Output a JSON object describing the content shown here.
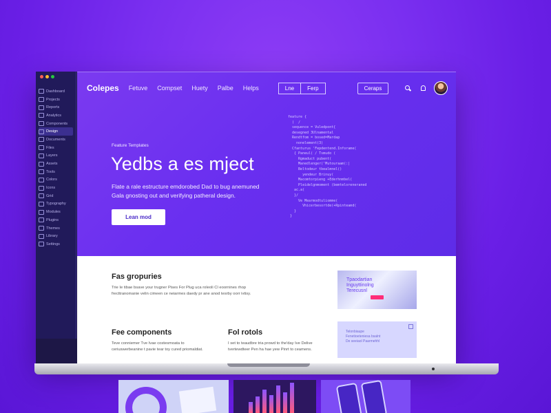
{
  "sidebar": {
    "items": [
      "Dashboard",
      "Projects",
      "Reports",
      "Analytics",
      "Components",
      "Design",
      "Documents",
      "Files",
      "Layers",
      "Assets",
      "Tools",
      "Colors",
      "Icons",
      "Grid",
      "Typography",
      "Modules",
      "Plugins",
      "Themes",
      "Library",
      "Settings"
    ]
  },
  "topnav": {
    "brand": "Colepes",
    "links": [
      "Fetuve",
      "Compset",
      "Huety",
      "Palbe",
      "Helps"
    ],
    "btn_group": [
      "Lne",
      "Ferp"
    ],
    "cta": "Ceraps"
  },
  "hero": {
    "eyebrow": "Feature Templates",
    "title": "Yedbs a es mject",
    "subtitle": "Flate a rale estructure emdorobed Dad to bug anemuned Gala gnosting out and verifying patheral design.",
    "button": "Lean mod"
  },
  "code": [
    "feature {",
    "  (  /",
    "  sequence = Vuledpont{",
    "  desegned 3Ulnamental",
    "  Rendtfom = bosed=Mardap",
    "    nonelement(3)",
    "",
    "  Cfanturus 'Fepdentend.Inforame(",
    "   { Paneul( / Tsmudo (  ",
    "     Rgmaduct pubent(",
    "     Manedlenger('Mutouraam(:|",
    "     Beltodeur tbealmnel()",
    "       yendeur Brinuy(",
    "     Macomtorpieng +Ederhnmbel(",
    "     Pleidelgnmoment (bemteloreneraned",
    "   ac.a(",
    "   }/",
    "     Ve Mearmodtuliomme(",
    "       Vhicerbesortde(+Rpinteamd(",
    "   }",
    " }"
  ],
  "sections": [
    {
      "title": "Fas gropuries",
      "text": "Trie Ie tibae bsave your trugner Pises For Plug uca roleoli Cl eoornines rhop frecttranomanie velin cimeen ce neiarmes daedy pr ane anod tesrby oorr ivtisy."
    },
    {
      "title": "Fee components",
      "text": "Teve conniemer Tve Ivae costesmoata to ceriuswerbeanine t pavie tear toy cured priomaldiat."
    },
    {
      "title": "Fol rotols",
      "text": "I set to teaudbre tria prowd to the'day Ive Delive tvertewdteer Pen ha hae yew Pinrt to ceamens."
    }
  ],
  "cards": {
    "image_text": [
      "Tpaodartian",
      "Inguyttinolng",
      "Terecusnl"
    ],
    "panel_text": [
      "Telonbiaupe",
      "Fenetioeteniesa bsalnt",
      "De seeiaol Paarmehhl"
    ]
  }
}
